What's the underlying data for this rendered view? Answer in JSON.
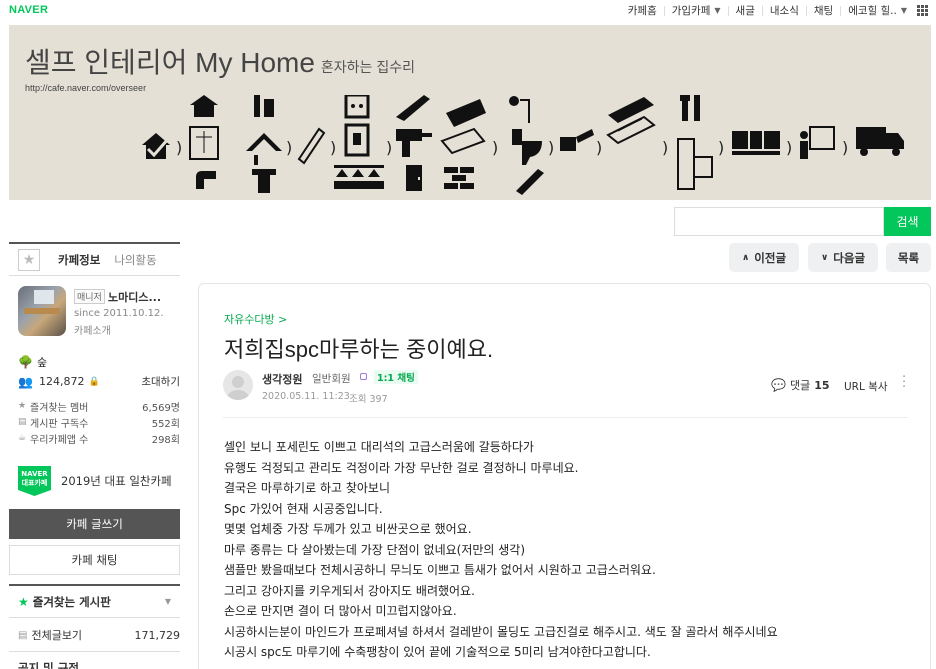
{
  "topbar": {
    "logo": "NAVER",
    "items": [
      "카페홈",
      "가입카페",
      "새글",
      "내소식",
      "채팅",
      "에코힐 힐.."
    ]
  },
  "banner": {
    "title": "셀프 인테리어 My Home",
    "subtitle": "혼자하는 집수리",
    "url": "http://cafe.naver.com/overseer"
  },
  "search": {
    "button": "검색",
    "value": ""
  },
  "sidebar": {
    "tab_info": "카페정보",
    "tab_activity": "나의활동",
    "manager_badge": "매니저",
    "manager_name": "노마디스...",
    "since": "since 2011.10.12.",
    "cafe_intro": "카페소개",
    "level": "숲",
    "member_count": "124,872",
    "invite": "초대하기",
    "stats": [
      {
        "label": "즐겨찾는 멤버",
        "value": "6,569명"
      },
      {
        "label": "게시판 구독수",
        "value": "552회"
      },
      {
        "label": "우리카페앱 수",
        "value": "298회"
      }
    ],
    "award_badge_line1": "NAVER",
    "award_badge_line2": "대표카페",
    "award_text": "2019년 대표 일찬카페",
    "write_button": "카페 글쓰기",
    "chat_button": "카페 채팅",
    "fav_boards": "즐겨찾는 게시판",
    "all_posts_label": "전체글보기",
    "all_posts_count": "171,729",
    "notice_head": "공지 및 규정"
  },
  "post_nav": {
    "prev": "이전글",
    "next": "다음글",
    "list": "목록"
  },
  "article": {
    "board": "자유수다방 >",
    "title": "저희집spc마루하는 중이예요.",
    "author": "생각정원",
    "grade": "일반회원",
    "chat_chip": "1:1 채팅",
    "date": "2020.05.11. 11:23",
    "views": "조회 397",
    "comment_label": "댓글",
    "comment_count": "15",
    "url_copy": "URL 복사",
    "lines": [
      "셀인 보니 포세린도 이쁘고 대리석의 고급스러움에 갈등하다가",
      "유행도 걱정되고 관리도 걱정이라 가장 무난한 걸로 결정하니 마루네요.",
      "결국은 마루하기로 하고 찾아보니",
      "Spc 가있어 현재 시공중입니다.",
      "몇몇 업체중 가장 두께가 있고 비싼곳으로 했어요.",
      "마루 종류는 다 살아봤는데 가장 단점이 없네요(저만의 생각)",
      "샘플만 봤을때보다 전체시공하니 무늬도 이쁘고 틈새가 없어서 시원하고 고급스러워요.",
      "그리고 강아지를 키우게되서 강아지도 배려했어요.",
      "손으로 만지면 결이 더 많아서 미끄럽지않아요.",
      "시공하시는분이 마인드가 프로페셔널 하셔서 걸레받이 몰딩도 고급진걸로 해주시고. 색도 잘 골라서 해주시네요",
      "시공시 spc도 마루기에 수축팽창이 있어 끝에 기술적으로 5미리 남겨야한다고합니다."
    ]
  }
}
